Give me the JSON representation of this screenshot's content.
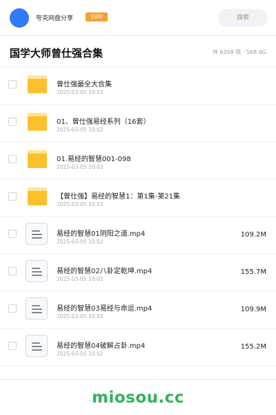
{
  "header": {
    "user_name": "夸克网盘分享",
    "badge": "SVIP",
    "search_placeholder": "搜索"
  },
  "share": {
    "title": "国学大师曾仕强合集",
    "stats": "共 6358 项 · 568.6G"
  },
  "colors": {
    "avatar": "#2f7cf6",
    "badge": "#f5a12c",
    "folder": "#fcc02c",
    "watermark": "#33b25b"
  },
  "files": [
    {
      "type": "folder",
      "icon": "folder-icon",
      "name": "曾仕强最全大合集",
      "date": "2025-03-05 10:02",
      "size": ""
    },
    {
      "type": "folder",
      "icon": "folder-icon",
      "name": "01、曾仕强易经系列（16套）",
      "date": "2025-03-05 10:02",
      "size": ""
    },
    {
      "type": "folder",
      "icon": "folder-icon",
      "name": "01.易经的智慧001-098",
      "date": "2025-03-05 10:02",
      "size": ""
    },
    {
      "type": "folder",
      "icon": "folder-icon",
      "name": "【曾仕强】易经的智慧1：第1集-第21集",
      "date": "2025-03-05 10:02",
      "size": ""
    },
    {
      "type": "file",
      "icon": "document-icon",
      "name": "易经的智慧01阴阳之道.mp4",
      "date": "2025-03-05 10:02",
      "size": "109.2M"
    },
    {
      "type": "file",
      "icon": "document-icon",
      "name": "易经的智慧02八卦定乾坤.mp4",
      "date": "2025-03-05 10:02",
      "size": "155.7M"
    },
    {
      "type": "file",
      "icon": "document-icon",
      "name": "易经的智慧03易经与命运.mp4",
      "date": "2025-03-05 10:02",
      "size": "109.9M"
    },
    {
      "type": "file",
      "icon": "document-icon",
      "name": "易经的智慧04破解占卦.mp4",
      "date": "2025-03-05 10:02",
      "size": "155.2M"
    }
  ],
  "watermark": "miosou.cc"
}
